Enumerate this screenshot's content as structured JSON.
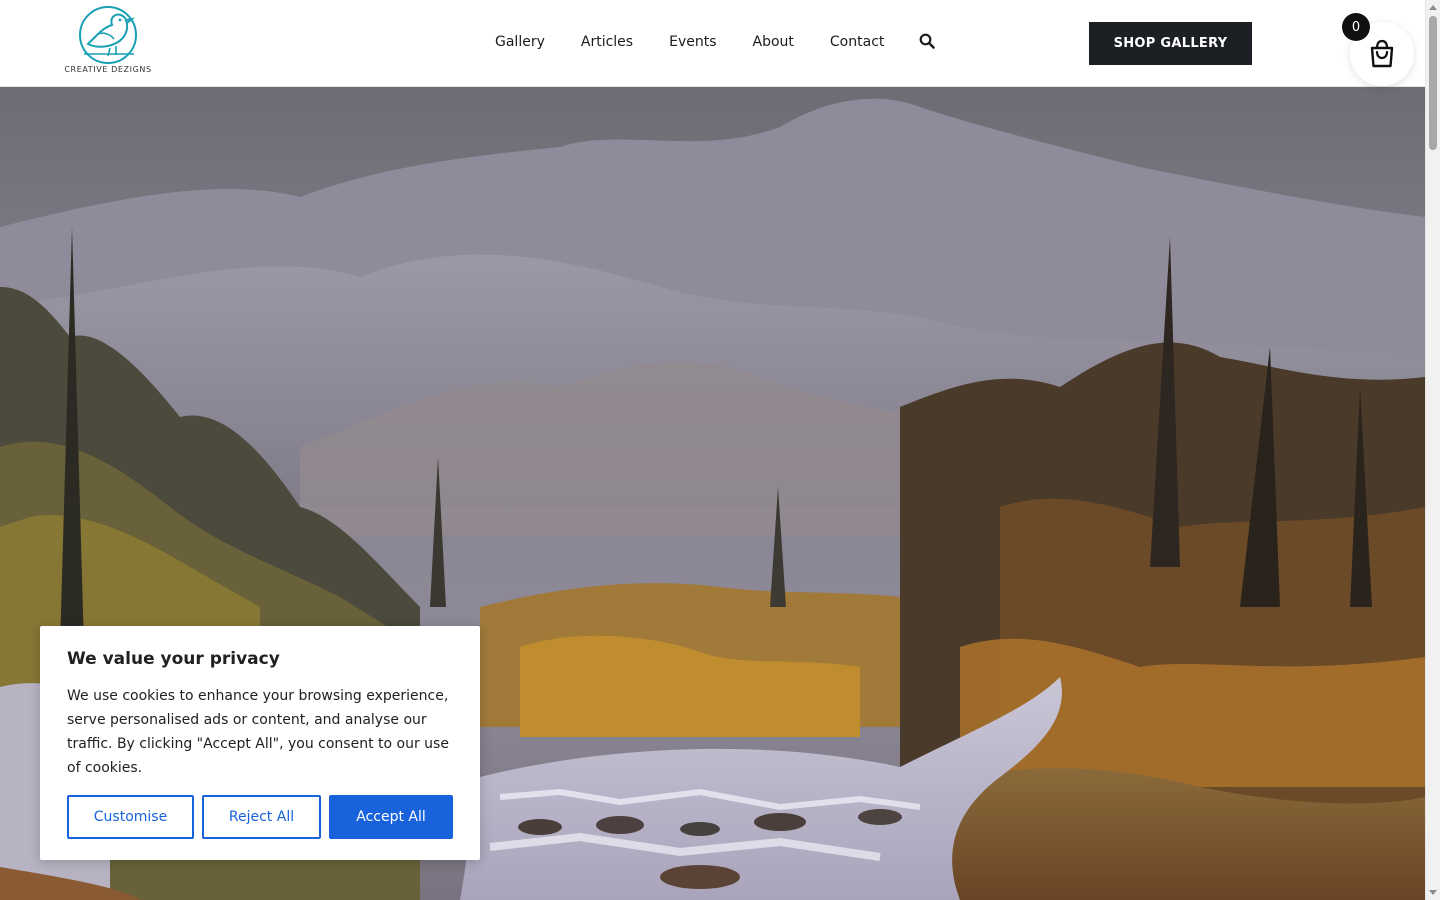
{
  "brand": {
    "logo_text": "CREATIVE DEZIGNS",
    "logo_icon": "bird-icon",
    "logo_color": "#1aa0b4"
  },
  "nav": {
    "items": [
      {
        "label": "Gallery"
      },
      {
        "label": "Articles"
      },
      {
        "label": "Events"
      },
      {
        "label": "About"
      },
      {
        "label": "Contact"
      }
    ],
    "search_icon": "search-icon"
  },
  "header": {
    "shop_label": "SHOP GALLERY",
    "cart_count": "0",
    "cart_icon": "shopping-bag-icon"
  },
  "hero": {
    "image": "landscape painting of misty mountains, autumn forest and river rapids"
  },
  "cookie": {
    "title": "We value your privacy",
    "text": "We use cookies to enhance your browsing experience, serve personalised ads or content, and analyse our traffic. By clicking \"Accept All\", you consent to our use of cookies.",
    "customise": "Customise",
    "reject": "Reject All",
    "accept": "Accept All",
    "accent": "#1863dc"
  },
  "colors": {
    "button_dark": "#1c1f24",
    "background": "#ffffff"
  }
}
